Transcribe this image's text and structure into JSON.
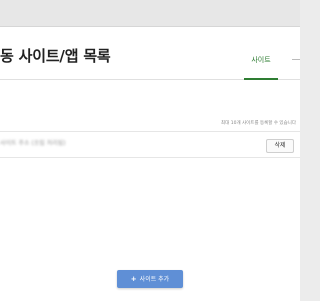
{
  "page": {
    "title": "동 사이트/앱 목록"
  },
  "tabs": [
    {
      "label": "사이트"
    }
  ],
  "info": {
    "limit_text": "최대 10개 사이트를 등록할 수 있습니다"
  },
  "sites": [
    {
      "name": "사이트 주소 (흐림 처리됨)",
      "delete_label": "삭제"
    }
  ],
  "actions": {
    "add_label": "사이트 추가"
  },
  "colors": {
    "accent": "#2e7d32",
    "primary_button": "#5f8fd6"
  },
  "icons": {
    "add": "plus-icon"
  }
}
